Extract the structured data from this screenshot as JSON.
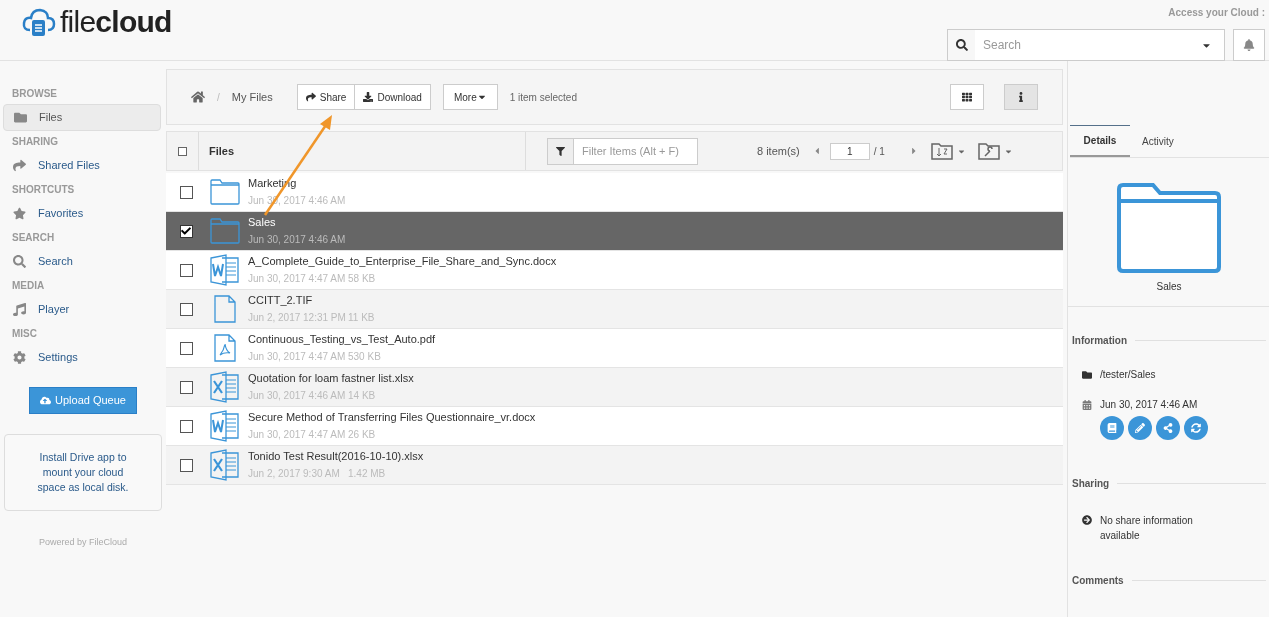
{
  "header": {
    "logo": "file**cloud**",
    "access_label": "Access your Cloud :",
    "search": {
      "placeholder": "Search"
    }
  },
  "sidebar": {
    "sections": [
      {
        "label": "BROWSE",
        "items": [
          {
            "label": "Files",
            "kind": "folder",
            "selected": true
          }
        ]
      },
      {
        "label": "SHARING",
        "items": [
          {
            "label": "Shared Files",
            "kind": "share",
            "selected": false
          }
        ]
      },
      {
        "label": "SHORTCUTS",
        "items": [
          {
            "label": "Favorites",
            "kind": "star",
            "selected": false
          }
        ]
      },
      {
        "label": "SEARCH",
        "items": [
          {
            "label": "Search",
            "kind": "search",
            "selected": false
          }
        ]
      },
      {
        "label": "MEDIA",
        "items": [
          {
            "label": "Player",
            "kind": "music",
            "selected": false
          }
        ]
      },
      {
        "label": "MISC",
        "items": [
          {
            "label": "Settings",
            "kind": "gear",
            "selected": false
          }
        ]
      }
    ],
    "upload_button": "Upload Queue",
    "drive_promo": "Install Drive app to mount your cloud space as local disk.",
    "powered_by": "Powered by FileCloud"
  },
  "toolbar": {
    "separator": "/",
    "breadcrumb": [
      "My Files"
    ],
    "buttons": [
      "Share",
      "Download"
    ],
    "more": "More",
    "selection_status": "1 item selected",
    "views": [
      {
        "kind": "grid",
        "selected": false
      },
      {
        "kind": "info",
        "selected": true
      }
    ]
  },
  "table": {
    "all_checked": false,
    "column": "Files",
    "filter": {
      "placeholder": "Filter Items (Alt + F)"
    },
    "count": "8 item(s)",
    "page": "1",
    "pages": "/ 1",
    "rows": [
      {
        "name": "Marketing",
        "kind": "folder",
        "date": "Jun 30, 2017 4:46 AM",
        "checked": false,
        "selected": false
      },
      {
        "name": "Sales",
        "kind": "folder",
        "date": "Jun 30, 2017 4:46 AM",
        "checked": true,
        "selected": true
      },
      {
        "name": "A_Complete_Guide_to_Enterprise_File_Share_and_Sync.docx",
        "kind": "word",
        "date": "Jun 30, 2017 4:47 AM",
        "size": "58 KB",
        "checked": false,
        "selected": false
      },
      {
        "name": "CCITT_2.TIF",
        "kind": "file",
        "date": "Jun 2, 2017 12:31 PM",
        "size": "11 KB",
        "checked": false,
        "selected": false
      },
      {
        "name": "Continuous_Testing_vs_Test_Auto.pdf",
        "kind": "pdf",
        "date": "Jun 30, 2017 4:47 AM",
        "size": "530 KB",
        "checked": false,
        "selected": false
      },
      {
        "name": "Quotation for loam fastner list.xlsx",
        "kind": "excel",
        "date": "Jun 30, 2017 4:46 AM",
        "size": "14 KB",
        "checked": false,
        "selected": false
      },
      {
        "name": "Secure Method of Transferring Files Questionnaire_vr.docx",
        "kind": "word",
        "date": "Jun 30, 2017 4:47 AM",
        "size": "26 KB",
        "checked": false,
        "selected": false
      },
      {
        "name": "Tonido Test Result(2016-10-10).xlsx",
        "kind": "excel",
        "date": "Jun 2, 2017 9:30 AM",
        "size": "1.42 MB",
        "checked": false,
        "selected": false
      }
    ]
  },
  "details": {
    "tabs": [
      {
        "label": "Details",
        "selected": true
      },
      {
        "label": "Activity",
        "selected": false
      }
    ],
    "name": "Sales",
    "information": {
      "heading": "Information",
      "path": "/tester/Sales",
      "date": "Jun 30, 2017 4:46 AM"
    },
    "sharing": {
      "heading": "Sharing",
      "message": "No share information available"
    },
    "comments": {
      "heading": "Comments"
    }
  }
}
